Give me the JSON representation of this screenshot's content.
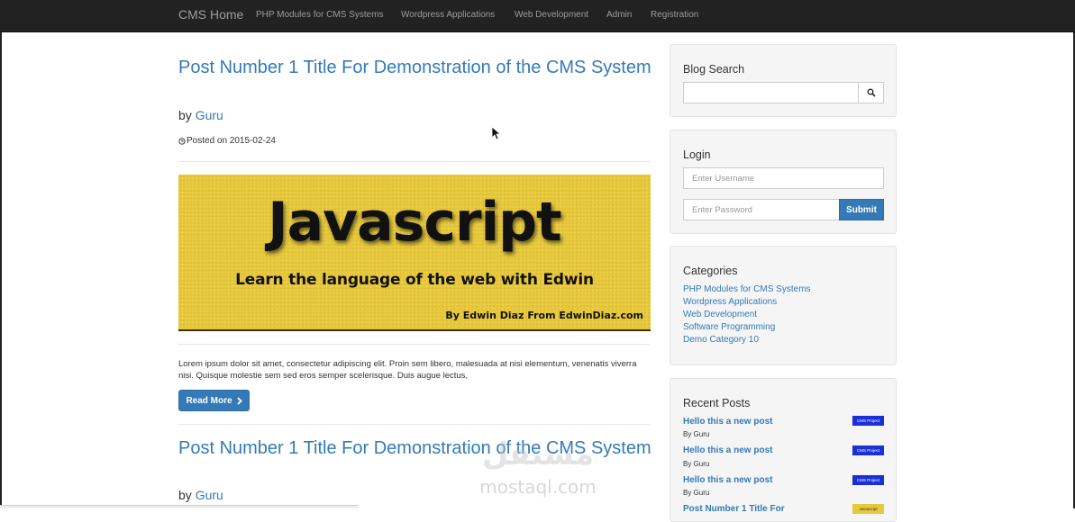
{
  "navbar": {
    "brand": "CMS Home",
    "links": [
      "PHP Modules for CMS Systems",
      "Wordpress Applications",
      "Web Development",
      "Admin",
      "Registration"
    ]
  },
  "posts": [
    {
      "title": "Post Number 1 Title For Demonstration of the CMS System",
      "by_prefix": "by",
      "author": "Guru",
      "posted": "Posted on 2015-02-24",
      "image": {
        "title": "Javascript",
        "subtitle": "Learn the language of the web with Edwin",
        "credit": "By Edwin Diaz From EdwinDiaz.com"
      },
      "excerpt": "Lorem ipsum dolor sit amet, consectetur adipiscing elit. Proin sem libero, malesuada at nisi elementum, venenatis viverra nisi. Quisque molestie sem sed eros semper scelerisque. Duis augue lectus,",
      "read_more": "Read More"
    },
    {
      "title": "Post Number 1 Title For Demonstration of the CMS System",
      "by_prefix": "by",
      "author": "Guru"
    }
  ],
  "sidebar": {
    "search": {
      "title": "Blog Search",
      "placeholder": ""
    },
    "login": {
      "title": "Login",
      "username_placeholder": "Enter Username",
      "password_placeholder": "Enter Password",
      "submit": "Submit"
    },
    "categories": {
      "title": "Categories",
      "items": [
        "PHP Modules for CMS Systems",
        "Wordpress Applications",
        "Web Development",
        "Software Programming",
        "Demo Category 10"
      ]
    },
    "recent": {
      "title": "Recent Posts",
      "items": [
        {
          "title": "Hello this a new post",
          "by": "By Guru",
          "thumb": "CMS Project"
        },
        {
          "title": "Hello this a new post",
          "by": "By Guru",
          "thumb": "CMS Project"
        },
        {
          "title": "Hello this a new post",
          "by": "By Guru",
          "thumb": "CMS Project"
        },
        {
          "title": "Post Number 1 Title For",
          "thumb": "Javascript"
        }
      ]
    }
  },
  "watermark": {
    "logo": "مستقل",
    "text": "mostaql.com"
  },
  "colors": {
    "navbar": "#222222",
    "link": "#337ab7",
    "primary_button": "#337ab7",
    "well": "#f5f5f5",
    "banner": "#e8c93c"
  }
}
